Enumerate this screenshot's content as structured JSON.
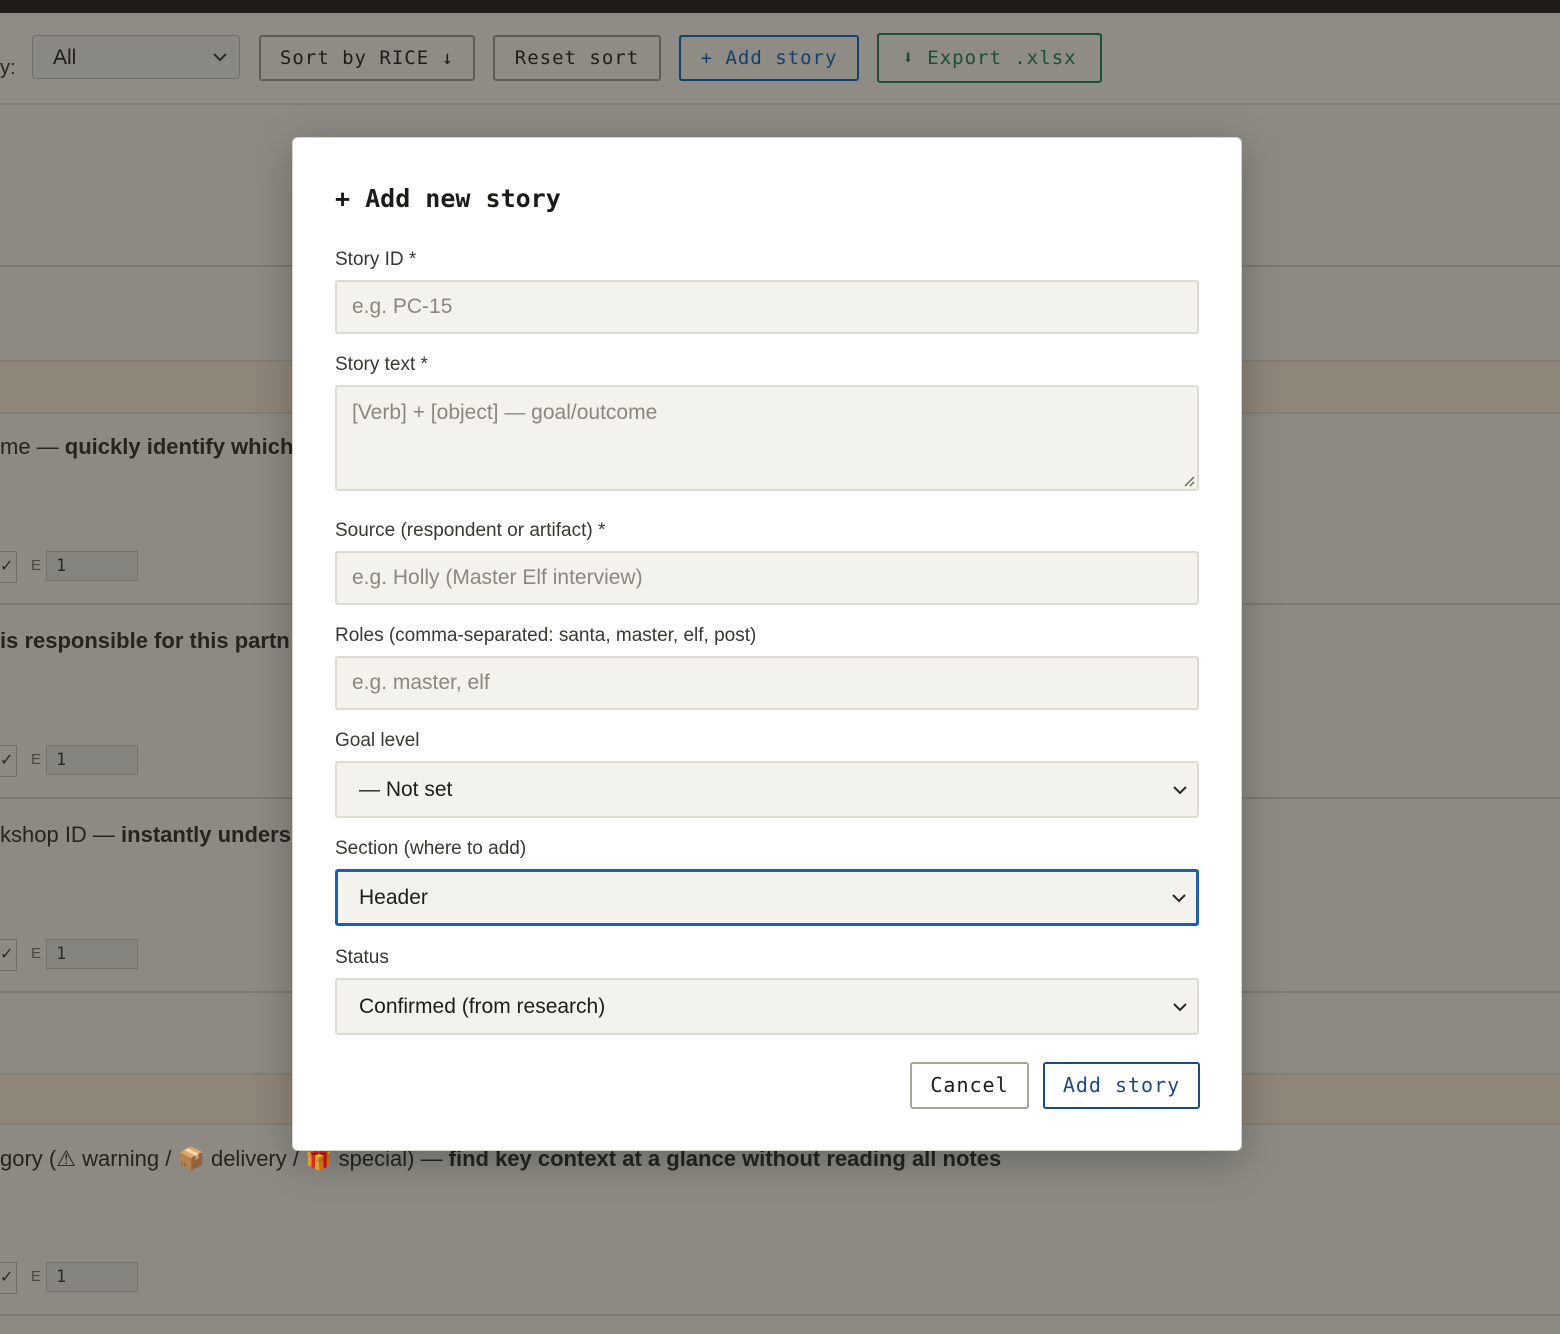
{
  "toolbar": {
    "filter_prefix": "y:",
    "filter_value": "All",
    "sort_button": "Sort by RICE ↓",
    "reset_button": "Reset sort",
    "add_button": "+ Add story",
    "export_button": "⬇ Export .xlsx"
  },
  "background_rows": [
    {
      "text_plain": "me — ",
      "text_bold": "quickly identify which",
      "rice_label": "E",
      "rice_value": "1"
    },
    {
      "text_plain": "",
      "text_bold": "is responsible for this partn",
      "rice_label": "E",
      "rice_value": "1"
    },
    {
      "text_plain": "kshop ID — ",
      "text_bold": "instantly unders",
      "rice_label": "E",
      "rice_value": "1"
    },
    {
      "text_plain": "gory (⚠ warning / 📦 delivery / 🎁 special) — ",
      "text_bold": "find key context at a glance without reading all notes",
      "rice_label": "E",
      "rice_value": "1"
    }
  ],
  "modal": {
    "title": "+ Add new story",
    "fields": {
      "story_id": {
        "label": "Story ID *",
        "placeholder": "e.g. PC-15"
      },
      "story_text": {
        "label": "Story text *",
        "placeholder": "[Verb] + [object] — goal/outcome"
      },
      "source": {
        "label": "Source (respondent or artifact) *",
        "placeholder": "e.g. Holly (Master Elf interview)"
      },
      "roles": {
        "label": "Roles (comma-separated: santa, master, elf, post)",
        "placeholder": "e.g. master, elf"
      },
      "goal_level": {
        "label": "Goal level",
        "value": "— Not set"
      },
      "section": {
        "label": "Section (where to add)",
        "value": "Header"
      },
      "status": {
        "label": "Status",
        "value": "Confirmed (from research)"
      }
    },
    "cancel_button": "Cancel",
    "submit_button": "Add story"
  },
  "colors": {
    "overlay": "#8c8a83",
    "focus_border": "#1f5fb3",
    "primary": "#1e4a84",
    "export_green": "#1d4f33"
  }
}
